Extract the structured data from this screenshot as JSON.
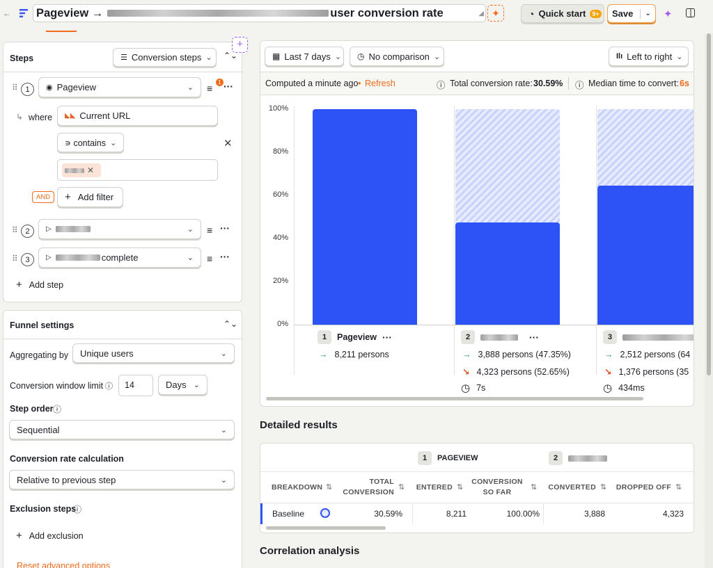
{
  "header": {
    "title_prefix": "Pageview →",
    "title_suffix": "user conversion rate",
    "quick_start_label": "Quick start",
    "quick_start_badge": "9+",
    "save_label": "Save"
  },
  "steps_panel": {
    "title": "Steps",
    "type_select": "Conversion steps",
    "steps": [
      {
        "num": "1",
        "event": "Pageview",
        "filter_badge": "1"
      },
      {
        "num": "2",
        "event": ""
      },
      {
        "num": "3",
        "event": "complete"
      }
    ],
    "where_label": "where",
    "filter_property": "Current URL",
    "filter_operator": "∍ contains",
    "and_label": "AND",
    "add_filter_label": "Add filter",
    "add_step_label": "Add step"
  },
  "funnel_settings": {
    "title": "Funnel settings",
    "aggregating_label": "Aggregating by",
    "aggregating_value": "Unique users",
    "window_label": "Conversion window limit",
    "window_value": "14",
    "window_unit": "Days",
    "step_order_label": "Step order",
    "step_order_value": "Sequential",
    "rate_calc_label": "Conversion rate calculation",
    "rate_calc_value": "Relative to previous step",
    "exclusion_label": "Exclusion steps",
    "add_exclusion_label": "Add exclusion",
    "reset_label": "Reset advanced options"
  },
  "toolbar": {
    "date_range": "Last 7 days",
    "comparison": "No comparison",
    "layout": "Left to right"
  },
  "summary": {
    "computed": "Computed a minute ago",
    "refresh": "Refresh",
    "total_label": "Total conversion rate:",
    "total_value": "30.59%",
    "median_label": "Median time to convert:",
    "median_value": "6s"
  },
  "chart_data": {
    "type": "bar",
    "categories": [
      "Pageview",
      "",
      ""
    ],
    "values": [
      100,
      47.35,
      64.6
    ],
    "ylim": [
      0,
      100
    ],
    "yticks": [
      "100%",
      "80%",
      "60%",
      "40%",
      "20%",
      "0%"
    ],
    "steps": [
      {
        "num": "1",
        "name": "Pageview",
        "converted": "8,211 persons",
        "dropped": "",
        "time": ""
      },
      {
        "num": "2",
        "name": "",
        "converted": "3,888 persons (47.35%)",
        "dropped": "4,323 persons (52.65%)",
        "time": "7s"
      },
      {
        "num": "3",
        "name": "",
        "converted": "2,512 persons (64",
        "dropped": "1,376 persons (35",
        "time": "434ms"
      }
    ]
  },
  "detailed": {
    "title": "Detailed results",
    "step1_label": "PAGEVIEW",
    "columns": [
      "BREAKDOWN",
      "TOTAL CONVERSION",
      "ENTERED",
      "CONVERSION SO FAR",
      "CONVERTED",
      "DROPPED OFF"
    ],
    "rows": [
      {
        "breakdown": "Baseline",
        "total_conversion": "30.59%",
        "entered": "8,211",
        "conversion_so_far": "100.00%",
        "converted": "3,888",
        "dropped_off": "4,323"
      }
    ]
  },
  "correlation": {
    "title": "Correlation analysis"
  },
  "colors": {
    "accent": "#f26a1b",
    "bar": "#2d52f5",
    "up": "#1a9c4b",
    "down": "#e04a1f"
  }
}
